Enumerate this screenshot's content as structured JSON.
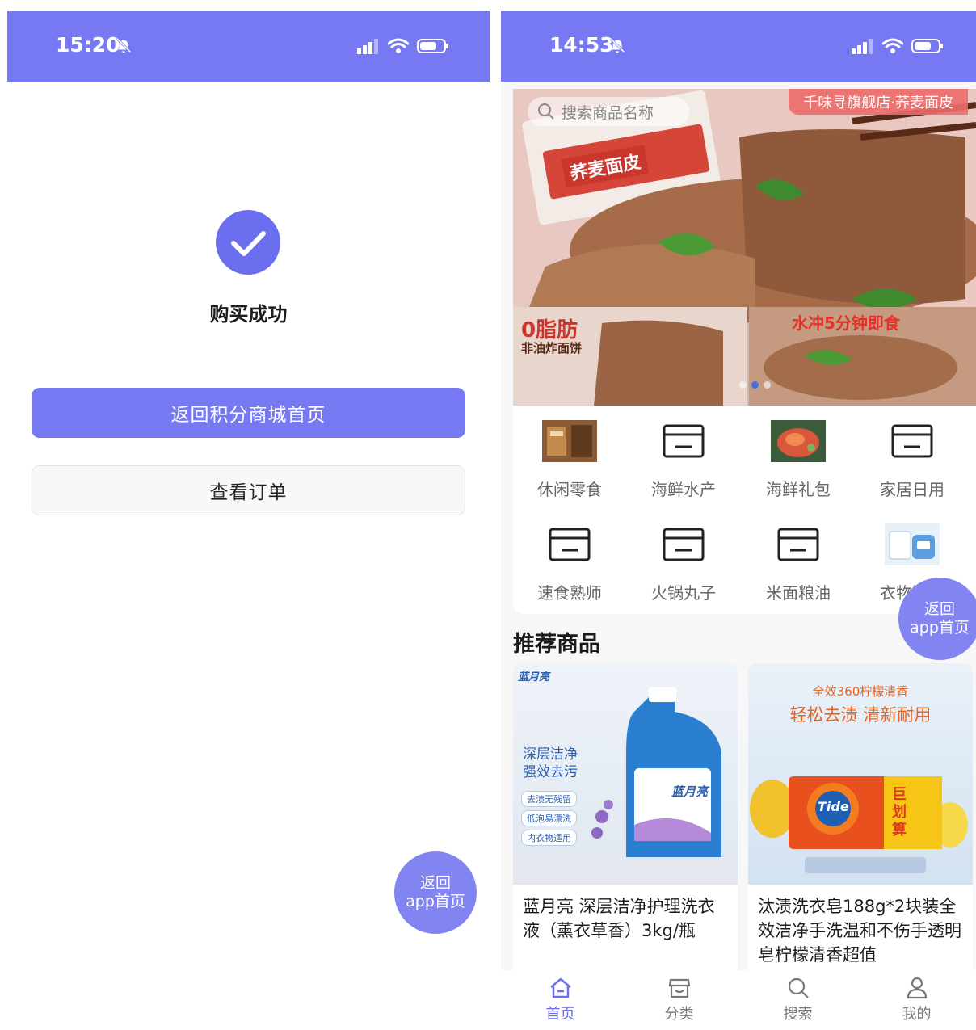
{
  "colors": {
    "accent": "#7779f2",
    "accent_dark": "#6c6ef0",
    "float_button": "#8284f1"
  },
  "left_screen": {
    "status": {
      "time": "15:20"
    },
    "result": {
      "title": "购买成功",
      "icon": "check-circle-icon"
    },
    "primary_button_label": "返回积分商城首页",
    "secondary_button_label": "查看订单",
    "float_button": {
      "line1": "返回",
      "line2": "app首页"
    }
  },
  "right_screen": {
    "status": {
      "time": "14:53"
    },
    "banner": {
      "search_placeholder": "搜索商品名称",
      "store_label": "千味寻旗舰店·荞麦面皮",
      "product_text": "荞麦面皮",
      "tag_fat": "0脂肪",
      "tag_fat_sub": "非油炸面饼",
      "tag_quick": "水冲5分钟即食",
      "slide_count": 3,
      "active_slide": 1
    },
    "categories": [
      {
        "label": "休闲零食",
        "icon": "snack-photo"
      },
      {
        "label": "海鲜水产",
        "icon": "placeholder-image-icon"
      },
      {
        "label": "海鲜礼包",
        "icon": "seafood-photo"
      },
      {
        "label": "家居日用",
        "icon": "placeholder-image-icon"
      },
      {
        "label": "速食熟师",
        "icon": "placeholder-image-icon"
      },
      {
        "label": "火锅丸子",
        "icon": "placeholder-image-icon"
      },
      {
        "label": "米面粮油",
        "icon": "placeholder-image-icon"
      },
      {
        "label": "衣物清洁",
        "icon": "detergent-photo"
      }
    ],
    "float_button": {
      "line1": "返回",
      "line2": "app首页"
    },
    "section_title": "推荐商品",
    "products": [
      {
        "name": "蓝月亮 深层洁净护理洗衣液（薰衣草香）3kg/瓶",
        "image": {
          "brand": "蓝月亮",
          "headline1": "深层洁净",
          "headline2": "强效去污",
          "chips": [
            "去渍无残留",
            "低泡易漂洗",
            "内衣物适用"
          ]
        }
      },
      {
        "name": "汰渍洗衣皂188g*2块装全效洁净手洗温和不伤手透明皂柠檬清香超值",
        "image": {
          "sub": "全效360柠檬清香",
          "headline": "轻松去渍 清新耐用",
          "brand": "Tide",
          "badge": "巨划算"
        }
      }
    ],
    "tabbar": [
      {
        "label": "首页",
        "icon": "home-icon",
        "active": true
      },
      {
        "label": "分类",
        "icon": "store-icon",
        "active": false
      },
      {
        "label": "搜索",
        "icon": "search-icon",
        "active": false
      },
      {
        "label": "我的",
        "icon": "user-icon",
        "active": false
      }
    ]
  }
}
